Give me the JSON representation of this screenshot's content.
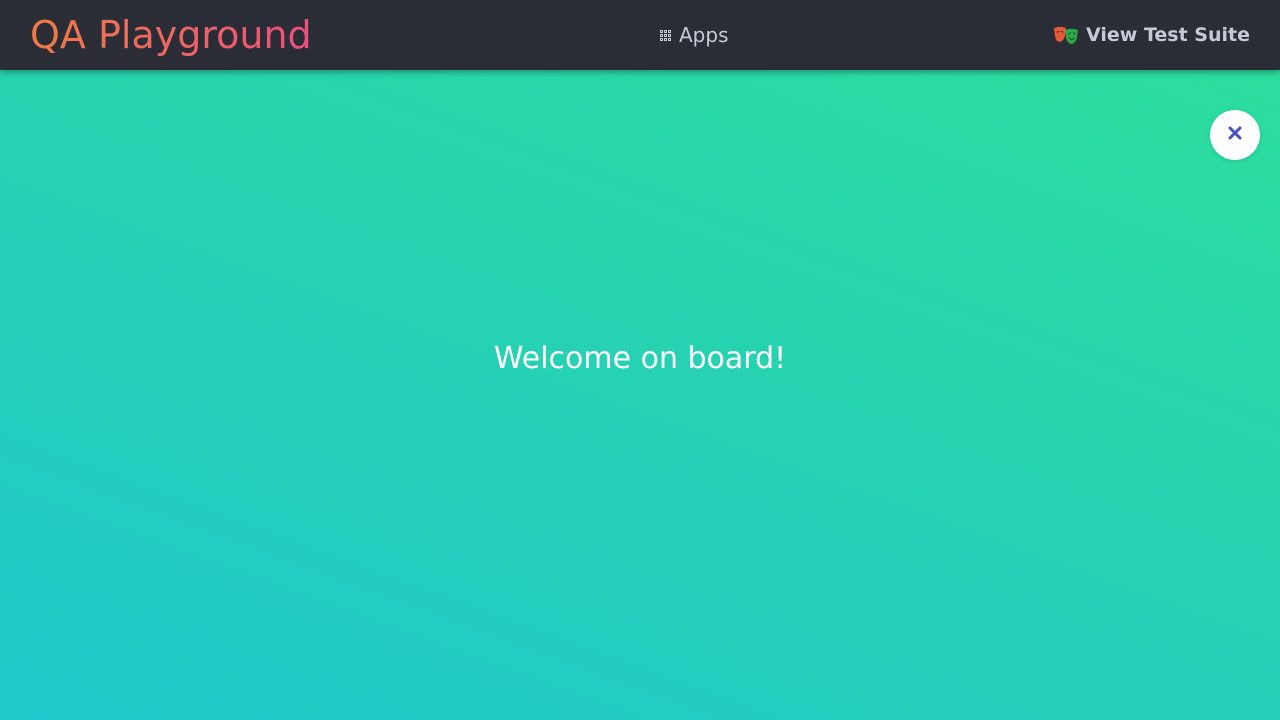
{
  "navbar": {
    "brand": "QA Playground",
    "apps_label": "Apps",
    "apps_icon": "grid-icon",
    "test_suite_label": "View Test Suite",
    "test_suite_icon": "theater-masks-icon"
  },
  "close_button": {
    "icon": "close-icon"
  },
  "main": {
    "welcome_text": "Welcome on board!"
  },
  "colors": {
    "navbar_bg": "#2a2d36",
    "brand_gradient_start": "#ef7c45",
    "brand_gradient_end": "#ec4f7d",
    "background_gradient_top": "#2ddf9b",
    "background_gradient_bottom": "#1fc9cc",
    "close_icon": "#4a4fc4",
    "nav_text": "#c7cad6"
  }
}
